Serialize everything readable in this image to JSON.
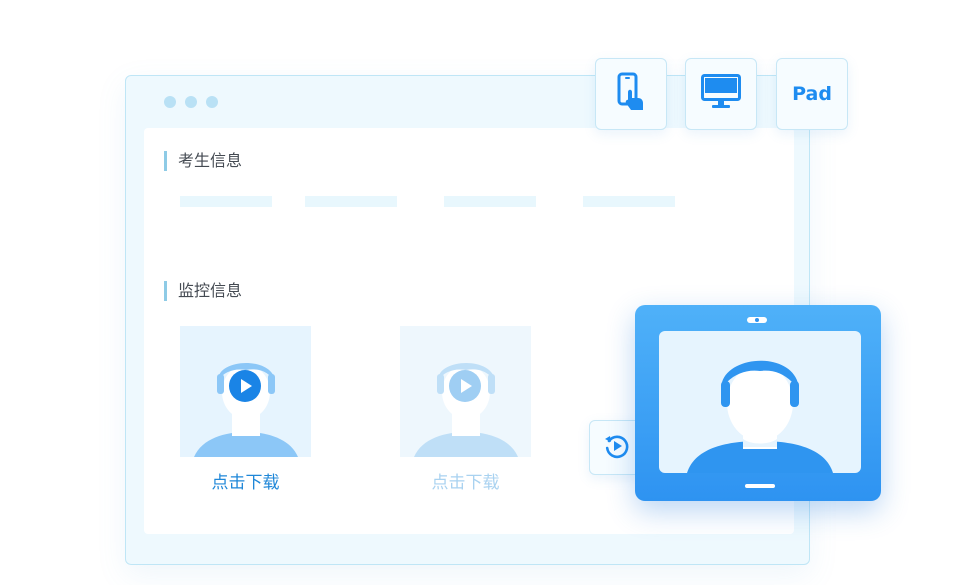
{
  "sections": {
    "candidate_info": "考生信息",
    "monitor_info": "监控信息"
  },
  "monitors": [
    {
      "download_label": "点击下载",
      "state": "active"
    },
    {
      "download_label": "点击下载",
      "state": "disabled"
    }
  ],
  "device_buttons": {
    "phone": "phone-icon",
    "desktop": "monitor-icon",
    "pad_label": "Pad"
  },
  "replay_icon": "replay-icon",
  "colors": {
    "accent": "#1e8cf0",
    "tablet": "#3a9ff4",
    "link_active": "#1f87d8",
    "link_disabled": "#a9d2f0"
  }
}
